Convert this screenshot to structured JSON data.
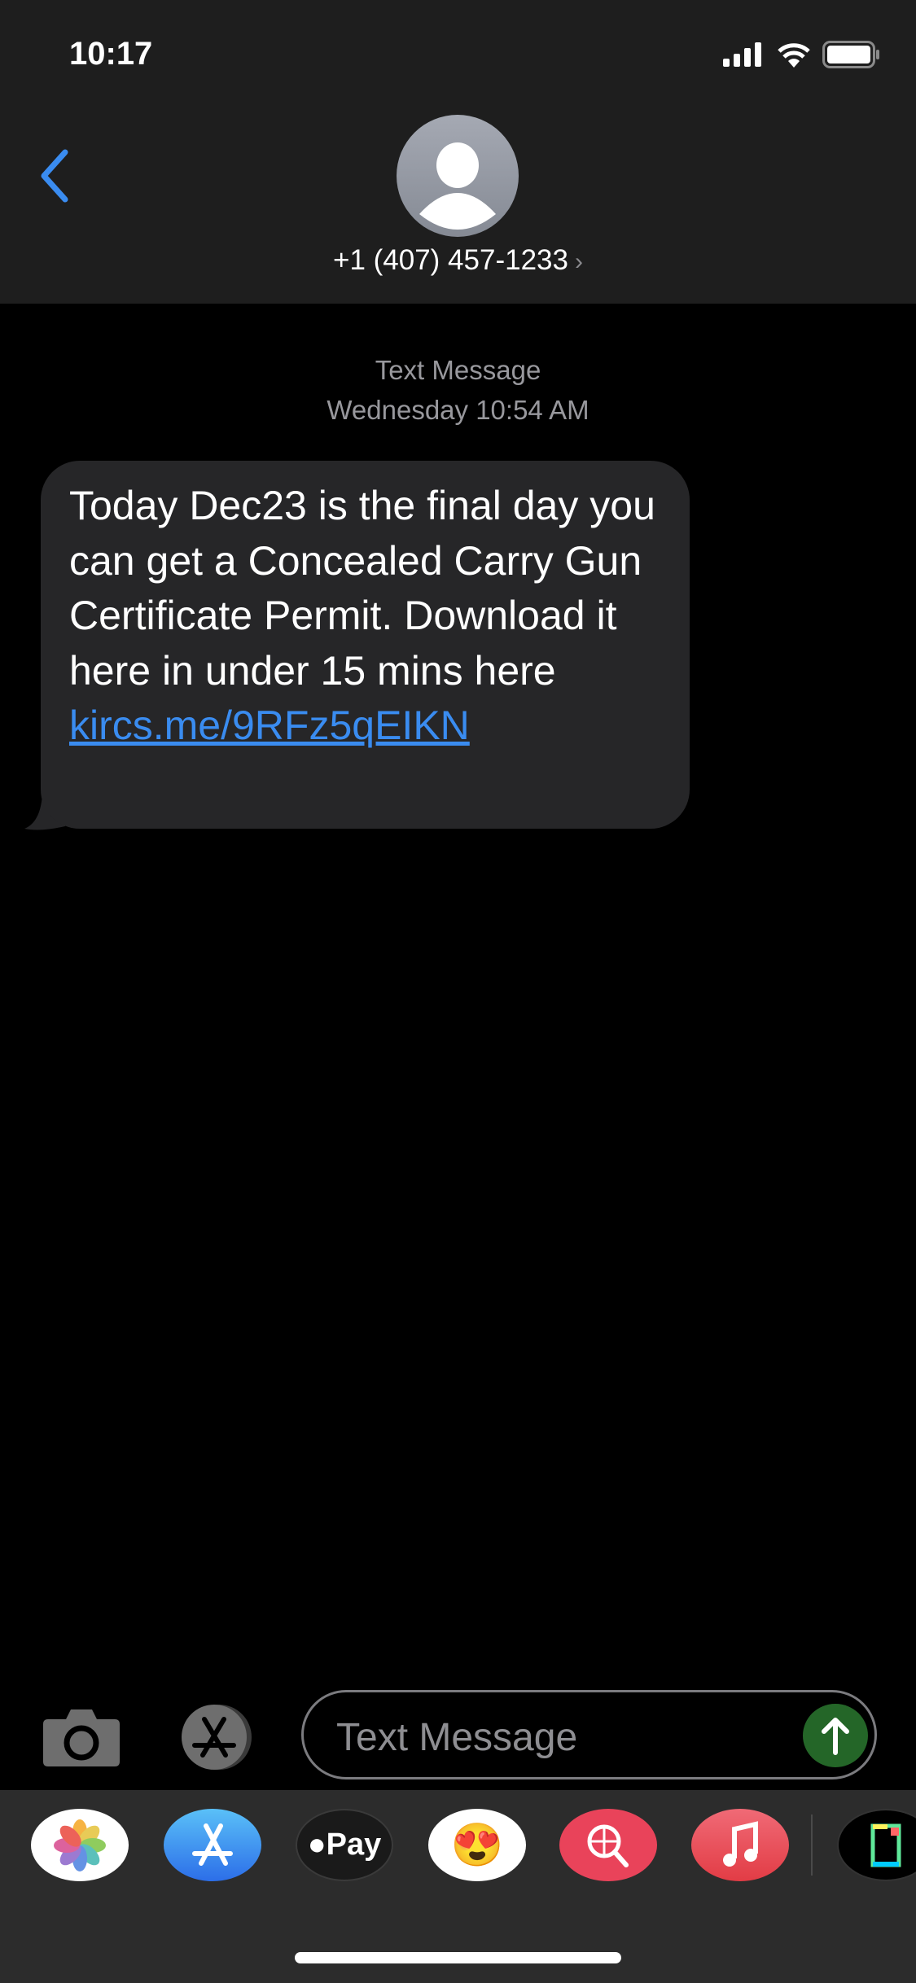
{
  "status_bar": {
    "time": "10:17",
    "icons": [
      "cellular-signal-icon",
      "wifi-icon",
      "battery-icon"
    ]
  },
  "header": {
    "contact": "+1 (407) 457-1233",
    "back_icon": "chevron-left-icon",
    "avatar_icon": "person-icon"
  },
  "thread": {
    "service": "Text Message",
    "timestamp": "Wednesday 10:54 AM"
  },
  "message": {
    "text": "Today Dec23 is the final day you can get a Concealed Carry Gun Certificate Permit. Download it here in under 15 mins here ",
    "link": "kircs.me/9RFz5qEIKN"
  },
  "compose": {
    "placeholder": "Text Message",
    "camera_icon": "camera-icon",
    "apps_icon": "app-store-icon",
    "send_icon": "arrow-up-icon"
  },
  "app_tray": {
    "apps": [
      "photos",
      "app-store",
      "apple-pay",
      "memoji",
      "image-search",
      "music",
      "giphy"
    ],
    "apple_pay_label": "Pay"
  },
  "colors": {
    "accent": "#3a8cf0",
    "send": "#246628",
    "bubble": "#262628"
  }
}
